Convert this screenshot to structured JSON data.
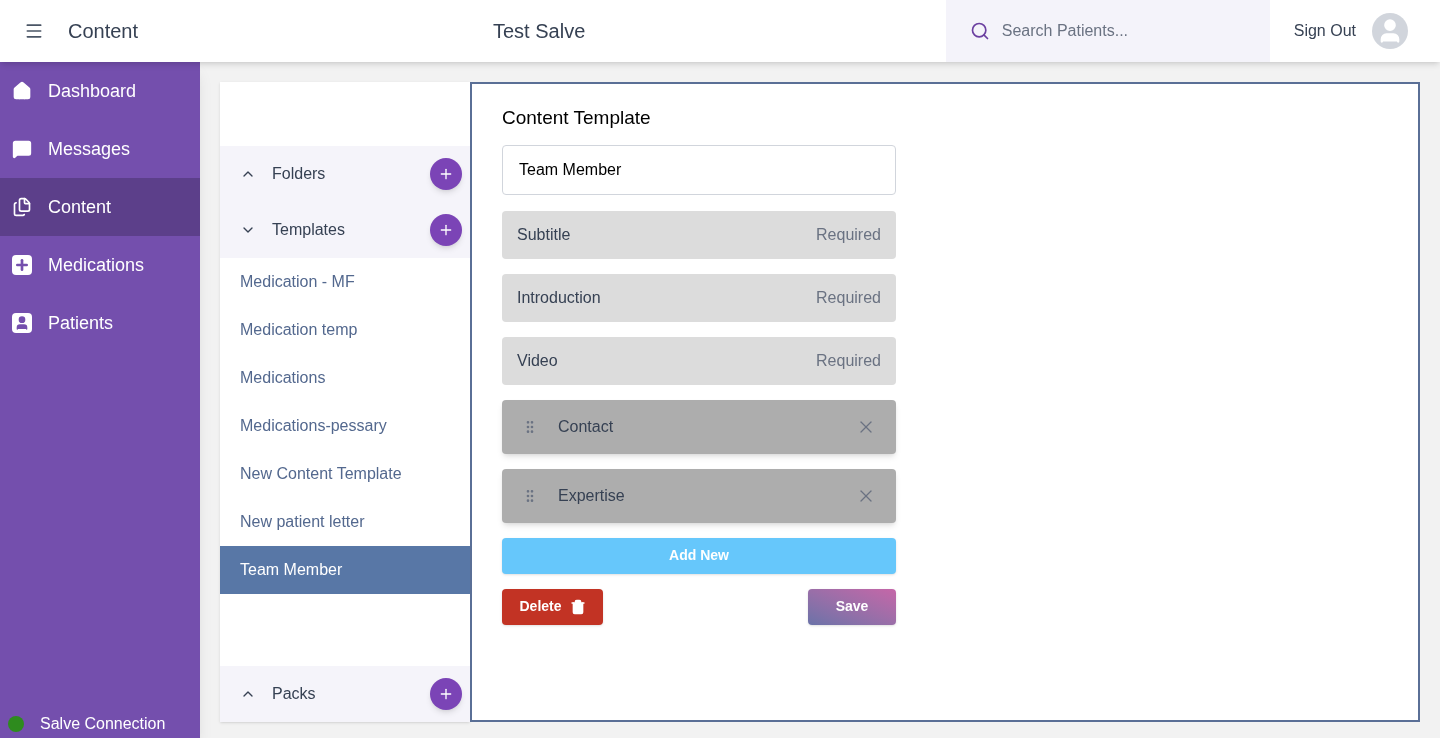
{
  "header": {
    "title": "Content",
    "app_name": "Test Salve",
    "search": {
      "placeholder": "Search Patients..."
    },
    "sign_out": "Sign Out"
  },
  "nav": {
    "items": [
      {
        "label": "Dashboard",
        "kind": "home",
        "selected": false
      },
      {
        "label": "Messages",
        "kind": "messages",
        "selected": false
      },
      {
        "label": "Content",
        "kind": "content",
        "selected": true
      },
      {
        "label": "Medications",
        "kind": "medications",
        "selected": false
      },
      {
        "label": "Patients",
        "kind": "patients",
        "selected": false
      }
    ],
    "connection": {
      "label": "Salve Connection",
      "connected": true
    }
  },
  "library": {
    "sections": [
      {
        "label": "Folders",
        "expanded": false
      },
      {
        "label": "Templates",
        "expanded": true,
        "items": [
          {
            "label": "Medication - MF",
            "selected": false
          },
          {
            "label": "Medication temp",
            "selected": false
          },
          {
            "label": "Medications",
            "selected": false
          },
          {
            "label": "Medications-pessary",
            "selected": false
          },
          {
            "label": "New Content Template",
            "selected": false
          },
          {
            "label": "New patient letter",
            "selected": false
          },
          {
            "label": "Team Member",
            "selected": true
          }
        ]
      }
    ],
    "packs": {
      "label": "Packs",
      "expanded": false
    }
  },
  "editor": {
    "title": "Content Template",
    "name_value": "Team Member",
    "fields": [
      {
        "kind": "fixed",
        "label": "Subtitle",
        "note": "Required"
      },
      {
        "kind": "fixed",
        "label": "Introduction",
        "note": "Required"
      },
      {
        "kind": "fixed",
        "label": "Video",
        "note": "Required"
      },
      {
        "kind": "custom",
        "label": "Contact"
      },
      {
        "kind": "custom",
        "label": "Expertise"
      }
    ],
    "add_button": "Add New",
    "delete_button": "Delete",
    "save_button": "Save"
  }
}
